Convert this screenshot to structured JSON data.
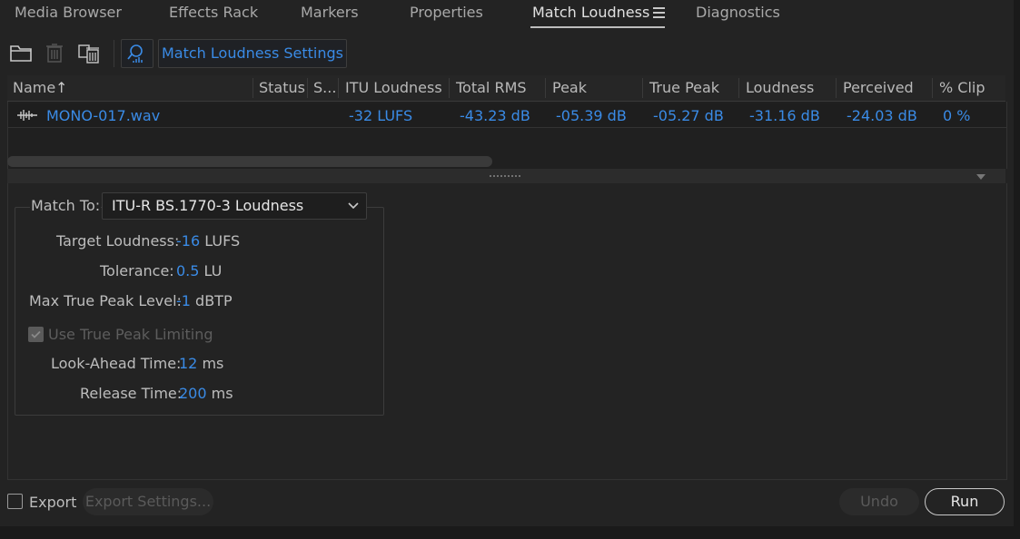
{
  "tabs": [
    {
      "label": "Media Browser",
      "active": false
    },
    {
      "label": "Effects Rack",
      "active": false
    },
    {
      "label": "Markers",
      "active": false
    },
    {
      "label": "Properties",
      "active": false
    },
    {
      "label": "Match Loudness",
      "active": true
    },
    {
      "label": "Diagnostics",
      "active": false
    }
  ],
  "toolbar": {
    "icons": [
      "folder-icon",
      "trash-icon",
      "clear-all-icon",
      "loudness-search-icon"
    ],
    "settings_button": "Match Loudness Settings"
  },
  "table": {
    "columns": [
      "Name",
      "Status",
      "S...",
      "ITU Loudness",
      "Total RMS",
      "Peak",
      "True Peak",
      "Loudness",
      "Perceived",
      "% Clip"
    ],
    "sort_indicator": "↑",
    "rows": [
      {
        "icon": "waveform-icon",
        "name": "MONO-017.wav",
        "status": "",
        "s": "",
        "itu_loudness": "-32 LUFS",
        "total_rms": "-43.23 dB",
        "peak": "-05.39 dB",
        "true_peak": "-05.27 dB",
        "loudness": "-31.16 dB",
        "perceived": "-24.03 dB",
        "clip": "0 %"
      }
    ]
  },
  "settings": {
    "match_to_label": "Match To:",
    "match_to_value": "ITU-R BS.1770-3 Loudness",
    "target_loudness_label": "Target Loudness:",
    "target_loudness_value": "-16",
    "target_loudness_unit": "LUFS",
    "tolerance_label": "Tolerance:",
    "tolerance_value": "0.5",
    "tolerance_unit": "LU",
    "max_true_peak_label": "Max True Peak Level:",
    "max_true_peak_value": "-1",
    "max_true_peak_unit": "dBTP",
    "use_true_peak_limiting_label": "Use True Peak Limiting",
    "use_true_peak_limiting_checked": true,
    "look_ahead_label": "Look-Ahead Time:",
    "look_ahead_value": "12",
    "look_ahead_unit": "ms",
    "release_label": "Release Time:",
    "release_value": "200",
    "release_unit": "ms"
  },
  "footer": {
    "export_label": "Export",
    "export_checked": false,
    "export_settings_label": "Export Settings...",
    "undo_label": "Undo",
    "run_label": "Run"
  },
  "colors": {
    "accent": "#3a8be6",
    "background": "#232323"
  }
}
